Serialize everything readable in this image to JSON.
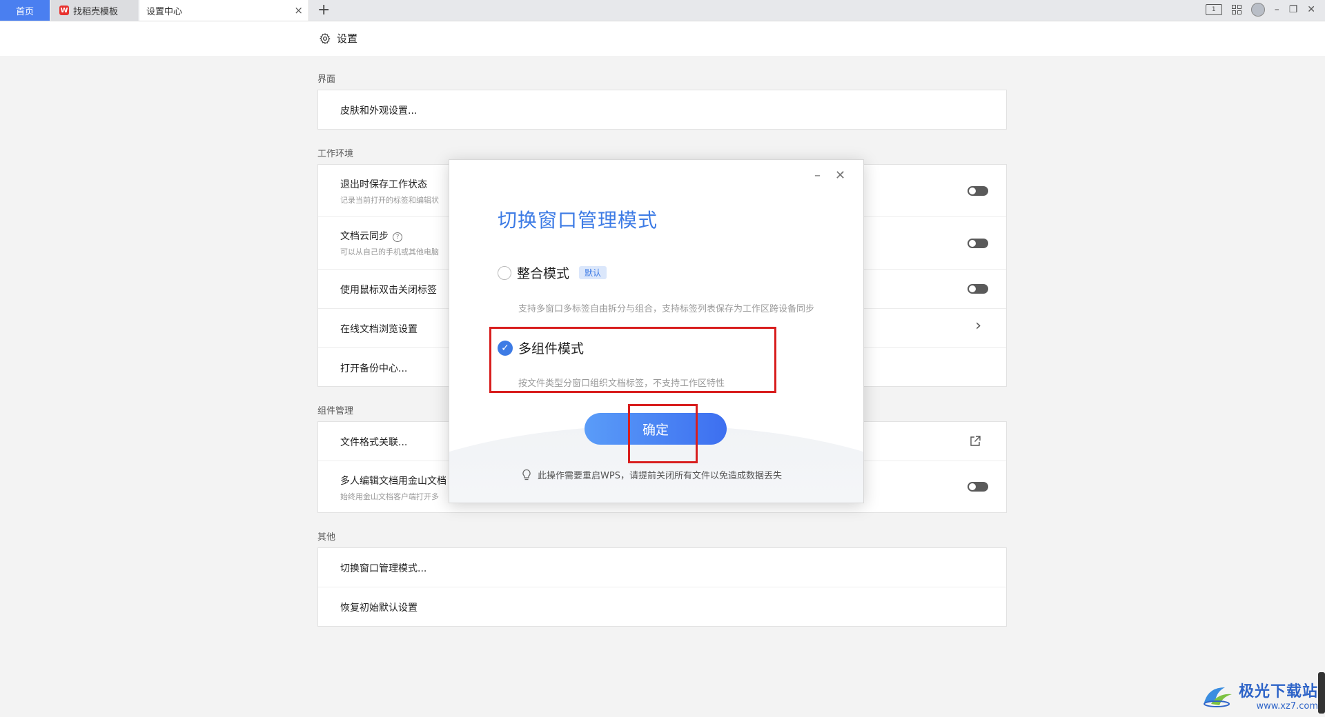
{
  "tabs": {
    "home": "首页",
    "template": "找稻壳模板",
    "template_logo": "W",
    "settings": "设置中心",
    "new_tab": "+",
    "close": "×"
  },
  "window_controls": {
    "layout_icon_text": "1",
    "minimize": "–",
    "restore": "❐",
    "close": "✕"
  },
  "header": {
    "title": "设置"
  },
  "sections": {
    "interface": {
      "title": "界面",
      "items": {
        "skin": "皮肤和外观设置..."
      }
    },
    "workspace": {
      "title": "工作环境",
      "items": {
        "save_on_exit": {
          "label": "退出时保存工作状态",
          "sub": "记录当前打开的标签和编辑状",
          "toggle": "off"
        },
        "cloud_sync": {
          "label": "文档云同步",
          "help": "?",
          "sub": "可以从自己的手机或其他电脑",
          "toggle": "off"
        },
        "dblclick_close": {
          "label": "使用鼠标双击关闭标签",
          "toggle": "off"
        },
        "online_browse": {
          "label": "在线文档浏览设置",
          "chevron": "›"
        },
        "backup": {
          "label": "打开备份中心..."
        }
      }
    },
    "components": {
      "title": "组件管理",
      "items": {
        "file_assoc": {
          "label": "文件格式关联..."
        },
        "multi_edit": {
          "label": "多人编辑文档用金山文档",
          "sub": "始终用金山文档客户端打开多",
          "toggle": "off"
        }
      }
    },
    "other": {
      "title": "其他",
      "items": {
        "switch_mode": {
          "label": "切换窗口管理模式..."
        },
        "restore_defaults": {
          "label": "恢复初始默认设置"
        }
      }
    }
  },
  "dialog": {
    "title": "切换窗口管理模式",
    "minimize": "–",
    "close": "✕",
    "option1": {
      "label": "整合模式",
      "badge": "默认",
      "desc": "支持多窗口多标签自由拆分与组合，支持标签列表保存为工作区跨设备同步",
      "selected": false
    },
    "option2": {
      "label": "多组件模式",
      "check": "✓",
      "desc": "按文件类型分窗口组织文档标签，不支持工作区特性",
      "selected": true
    },
    "confirm": "确定",
    "tip": "此操作需要重启WPS，请提前关闭所有文件以免造成数据丢失"
  },
  "watermark": {
    "name": "极光下载站",
    "url": "www.xz7.com"
  },
  "colors": {
    "accent": "#3d7be5",
    "highlight": "#d81e1e",
    "toggle_off": "#5a5a5a",
    "home_tab": "#4a7ff0"
  }
}
